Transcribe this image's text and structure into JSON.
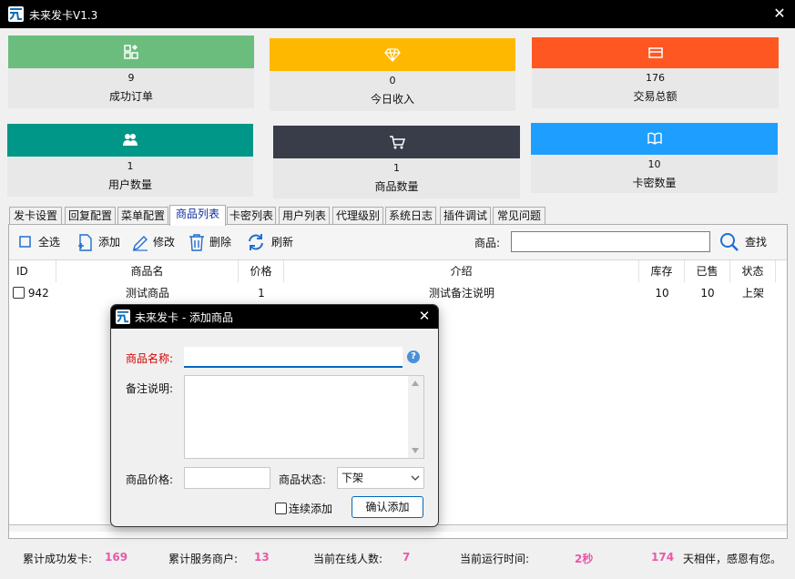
{
  "window": {
    "title": "未来发卡V1.3"
  },
  "cards": [
    {
      "value": "9",
      "label": "成功订单",
      "color": "#6bbd7d",
      "icon": "apps-icon"
    },
    {
      "value": "0",
      "label": "今日收入",
      "color": "#ffb800",
      "icon": "diamond-icon"
    },
    {
      "value": "176",
      "label": "交易总额",
      "color": "#ff5722",
      "icon": "card-icon"
    },
    {
      "value": "1",
      "label": "用户数量",
      "color": "#009688",
      "icon": "users-icon"
    },
    {
      "value": "1",
      "label": "商品数量",
      "color": "#393d49",
      "icon": "cart-icon"
    },
    {
      "value": "10",
      "label": "卡密数量",
      "color": "#1e9fff",
      "icon": "book-icon"
    }
  ],
  "tabs": [
    "发卡设置",
    "回复配置",
    "菜单配置",
    "商品列表",
    "卡密列表",
    "用户列表",
    "代理级别",
    "系统日志",
    "插件调试",
    "常见问题"
  ],
  "active_tab": "商品列表",
  "toolbar": {
    "select_all": "全选",
    "add": "添加",
    "edit": "修改",
    "delete": "删除",
    "refresh": "刷新",
    "search_label": "商品:",
    "search_value": "",
    "search_button": "查找"
  },
  "table": {
    "columns": [
      "ID",
      "商品名",
      "价格",
      "介绍",
      "库存",
      "已售",
      "状态"
    ],
    "rows": [
      {
        "id": "942",
        "name": "测试商品",
        "price": "1",
        "desc": "测试备注说明",
        "stock": "10",
        "sold": "10",
        "status": "上架"
      }
    ]
  },
  "status_bar": {
    "total_label": "累计成功发卡:",
    "total_value": "169",
    "merchants_label": "累计服务商户:",
    "merchants_value": "13",
    "online_label": "当前在线人数:",
    "online_value": "7",
    "runtime_label": "当前运行时间:",
    "runtime_value": "2秒",
    "days_value": "174",
    "days_suffix": "天相伴，感恩有您。"
  },
  "dialog": {
    "title": "未来发卡 - 添加商品",
    "name_label": "商品名称:",
    "name_value": "",
    "remark_label": "备注说明:",
    "remark_value": "",
    "price_label": "商品价格:",
    "price_value": "",
    "state_label": "商品状态:",
    "state_value": "下架",
    "continuous_label": "连续添加",
    "confirm_label": "确认添加",
    "help_glyph": "?"
  },
  "colors": {
    "accent": "#0067c0",
    "highlight": "#e75aa7",
    "required": "#d40000"
  }
}
